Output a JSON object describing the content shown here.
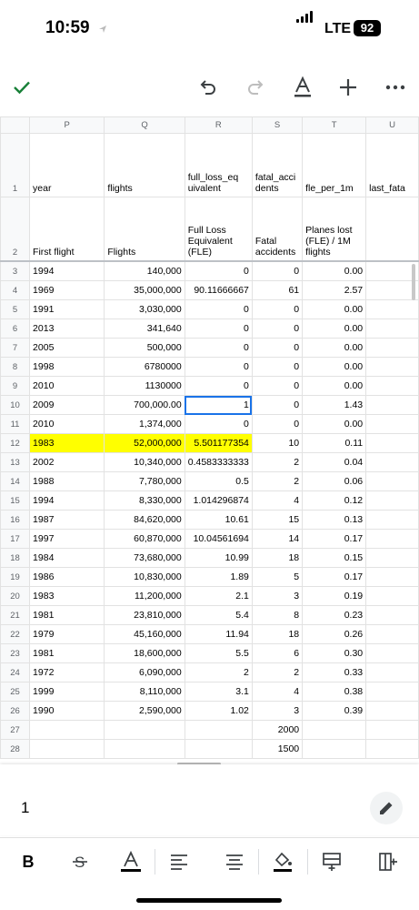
{
  "status": {
    "time": "10:59",
    "network": "LTE",
    "battery": "92"
  },
  "sheet": {
    "columns": [
      "P",
      "Q",
      "R",
      "S",
      "T",
      "U"
    ],
    "row1": {
      "num": "1",
      "cells": [
        "year",
        "flights",
        "full_loss_eq uivalent",
        "fatal_acci dents",
        "fle_per_1m",
        "last_fata"
      ]
    },
    "row2": {
      "num": "2",
      "cells": [
        "First flight",
        "Flights",
        "Full Loss Equivalent (FLE)",
        "Fatal accidents",
        "Planes lost (FLE) / 1M flights",
        ""
      ]
    },
    "rows": [
      {
        "num": "3",
        "cells": [
          "1994",
          "140,000",
          "0",
          "0",
          "0.00",
          ""
        ]
      },
      {
        "num": "4",
        "cells": [
          "1969",
          "35,000,000",
          "90.11666667",
          "61",
          "2.57",
          ""
        ]
      },
      {
        "num": "5",
        "cells": [
          "1991",
          "3,030,000",
          "0",
          "0",
          "0.00",
          ""
        ]
      },
      {
        "num": "6",
        "cells": [
          "2013",
          "341,640",
          "0",
          "0",
          "0.00",
          ""
        ]
      },
      {
        "num": "7",
        "cells": [
          "2005",
          "500,000",
          "0",
          "0",
          "0.00",
          ""
        ]
      },
      {
        "num": "8",
        "cells": [
          "1998",
          "6780000",
          "0",
          "0",
          "0.00",
          ""
        ]
      },
      {
        "num": "9",
        "cells": [
          "2010",
          "1130000",
          "0",
          "0",
          "0.00",
          ""
        ]
      },
      {
        "num": "10",
        "cells": [
          "2009",
          "700,000.00",
          "1",
          "0",
          "1.43",
          ""
        ]
      },
      {
        "num": "11",
        "cells": [
          "2010",
          "1,374,000",
          "0",
          "0",
          "0.00",
          ""
        ]
      },
      {
        "num": "12",
        "cells": [
          "1983",
          "52,000,000",
          "5.501177354",
          "10",
          "0.11",
          ""
        ]
      },
      {
        "num": "13",
        "cells": [
          "2002",
          "10,340,000",
          "0.4583333333",
          "2",
          "0.04",
          ""
        ]
      },
      {
        "num": "14",
        "cells": [
          "1988",
          "7,780,000",
          "0.5",
          "2",
          "0.06",
          ""
        ]
      },
      {
        "num": "15",
        "cells": [
          "1994",
          "8,330,000",
          "1.014296874",
          "4",
          "0.12",
          ""
        ]
      },
      {
        "num": "16",
        "cells": [
          "1987",
          "84,620,000",
          "10.61",
          "15",
          "0.13",
          ""
        ]
      },
      {
        "num": "17",
        "cells": [
          "1997",
          "60,870,000",
          "10.04561694",
          "14",
          "0.17",
          ""
        ]
      },
      {
        "num": "18",
        "cells": [
          "1984",
          "73,680,000",
          "10.99",
          "18",
          "0.15",
          ""
        ]
      },
      {
        "num": "19",
        "cells": [
          "1986",
          "10,830,000",
          "1.89",
          "5",
          "0.17",
          ""
        ]
      },
      {
        "num": "20",
        "cells": [
          "1983",
          "11,200,000",
          "2.1",
          "3",
          "0.19",
          ""
        ]
      },
      {
        "num": "21",
        "cells": [
          "1981",
          "23,810,000",
          "5.4",
          "8",
          "0.23",
          ""
        ]
      },
      {
        "num": "22",
        "cells": [
          "1979",
          "45,160,000",
          "11.94",
          "18",
          "0.26",
          ""
        ]
      },
      {
        "num": "23",
        "cells": [
          "1981",
          "18,600,000",
          "5.5",
          "6",
          "0.30",
          ""
        ]
      },
      {
        "num": "24",
        "cells": [
          "1972",
          "6,090,000",
          "2",
          "2",
          "0.33",
          ""
        ]
      },
      {
        "num": "25",
        "cells": [
          "1999",
          "8,110,000",
          "3.1",
          "4",
          "0.38",
          ""
        ]
      },
      {
        "num": "26",
        "cells": [
          "1990",
          "2,590,000",
          "1.02",
          "3",
          "0.39",
          ""
        ]
      },
      {
        "num": "27",
        "cells": [
          "",
          "",
          "",
          "2000",
          "",
          ""
        ]
      },
      {
        "num": "28",
        "cells": [
          "",
          "",
          "",
          "1500",
          "",
          ""
        ]
      }
    ],
    "highlight_row": "12",
    "highlight_color": "#ffff00",
    "selected_cell": "R10",
    "selection_color": "#1a73e8"
  },
  "editor": {
    "value": "1"
  },
  "toolbar_icons": [
    "check-icon",
    "undo-icon",
    "redo-icon",
    "text-format-icon",
    "add-icon",
    "more-icon"
  ],
  "format_icons": [
    "bold-icon",
    "strikethrough-icon",
    "text-color-icon",
    "align-left-icon",
    "align-center-icon",
    "fill-color-icon",
    "insert-row-icon",
    "insert-column-icon"
  ]
}
